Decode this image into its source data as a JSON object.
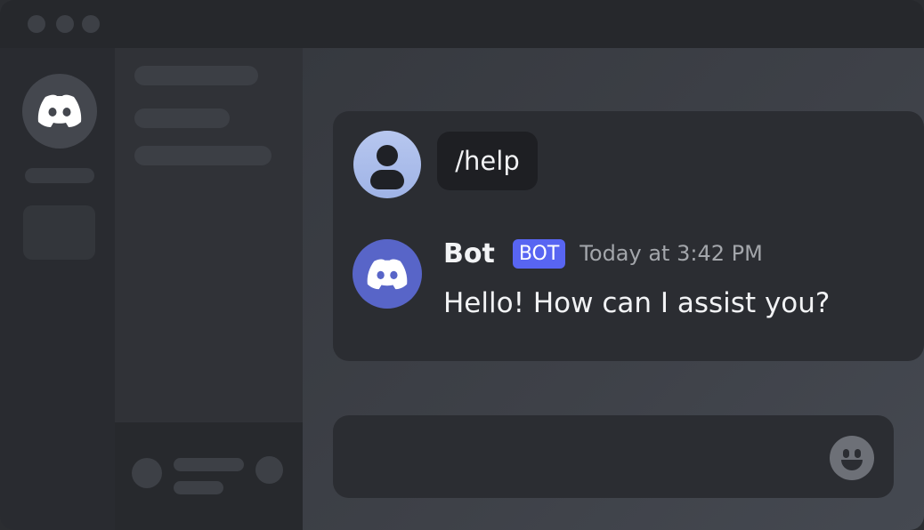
{
  "window": {
    "title": ""
  },
  "server_rail": {
    "server_icon": "discord-logo-icon"
  },
  "chat": {
    "command_message": {
      "text": "/help",
      "avatar_icon": "user-avatar-icon"
    },
    "bot_message": {
      "author": "Bot",
      "tag": "BOT",
      "timestamp": "Today at 3:42 PM",
      "text": "Hello! How can I assist you?",
      "avatar_icon": "discord-logo-icon"
    }
  },
  "composer": {
    "emoji_icon": "smiley-face-icon"
  },
  "colors": {
    "accent": "#5865f2",
    "bot_avatar": "#5865c8",
    "user_avatar": "#a9bbea",
    "timestamp": "#a3a6ab"
  }
}
